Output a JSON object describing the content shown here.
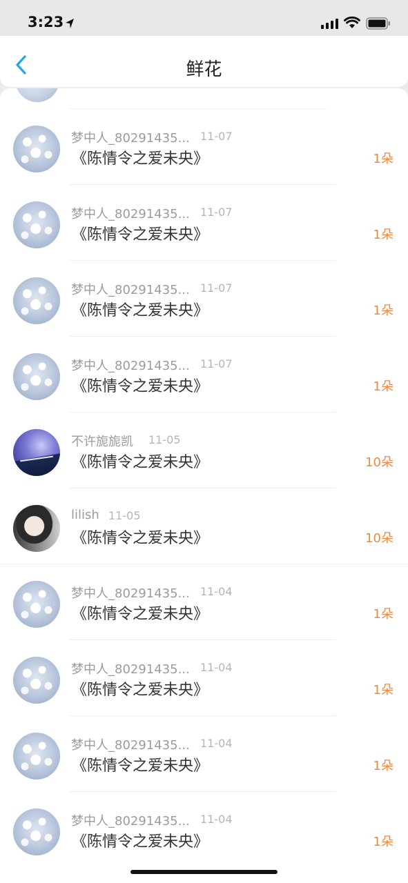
{
  "status_bar": {
    "time": "3:23"
  },
  "header": {
    "title": "鲜花"
  },
  "rows": [
    {
      "user": "梦中人_80291435...",
      "date": "11-07",
      "title": "《陈情令之爱未央》",
      "count": "1朵",
      "avatar": "flower-avatar"
    },
    {
      "user": "梦中人_80291435...",
      "date": "11-07",
      "title": "《陈情令之爱未央》",
      "count": "1朵",
      "avatar": "flower-avatar"
    },
    {
      "user": "梦中人_80291435...",
      "date": "11-07",
      "title": "《陈情令之爱未央》",
      "count": "1朵",
      "avatar": "flower-avatar"
    },
    {
      "user": "梦中人_80291435...",
      "date": "11-07",
      "title": "《陈情令之爱未央》",
      "count": "1朵",
      "avatar": "flower-avatar"
    },
    {
      "user": "不许旎旎凯",
      "date": "11-05",
      "title": "《陈情令之爱未央》",
      "count": "10朵",
      "avatar": "galaxy-avatar"
    },
    {
      "user": "lilish",
      "date": "11-05",
      "title": "《陈情令之爱未央》",
      "count": "10朵",
      "avatar": "portrait-avatar"
    },
    {
      "user": "梦中人_80291435...",
      "date": "11-04",
      "title": "《陈情令之爱未央》",
      "count": "1朵",
      "avatar": "flower-avatar"
    },
    {
      "user": "梦中人_80291435...",
      "date": "11-04",
      "title": "《陈情令之爱未央》",
      "count": "1朵",
      "avatar": "flower-avatar"
    },
    {
      "user": "梦中人_80291435...",
      "date": "11-04",
      "title": "《陈情令之爱未央》",
      "count": "1朵",
      "avatar": "flower-avatar"
    },
    {
      "user": "梦中人_80291435...",
      "date": "11-04",
      "title": "《陈情令之爱未央》",
      "count": "1朵",
      "avatar": "flower-avatar"
    }
  ],
  "colors": {
    "count": "#f0893c",
    "back_arrow": "#2aa3e8"
  }
}
